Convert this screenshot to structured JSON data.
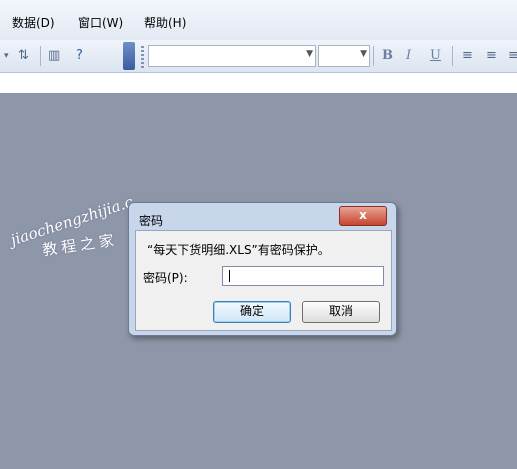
{
  "menu": {
    "items": [
      {
        "label": "数据(D)"
      },
      {
        "label": "窗口(W)"
      },
      {
        "label": "帮助(H)"
      }
    ]
  },
  "toolbar": {
    "font_name": "",
    "font_size": "",
    "bold": "B",
    "italic": "I",
    "underline": "U"
  },
  "dialog": {
    "title": "密码",
    "close": "x",
    "message": "“每天下货明细.XLS”有密码保护。",
    "password_label": "密码(P):",
    "password_value": "",
    "ok_label": "确定",
    "cancel_label": "取消"
  },
  "watermark": {
    "line1": "jiaochengzhijia.c",
    "line2": "教程之家"
  }
}
